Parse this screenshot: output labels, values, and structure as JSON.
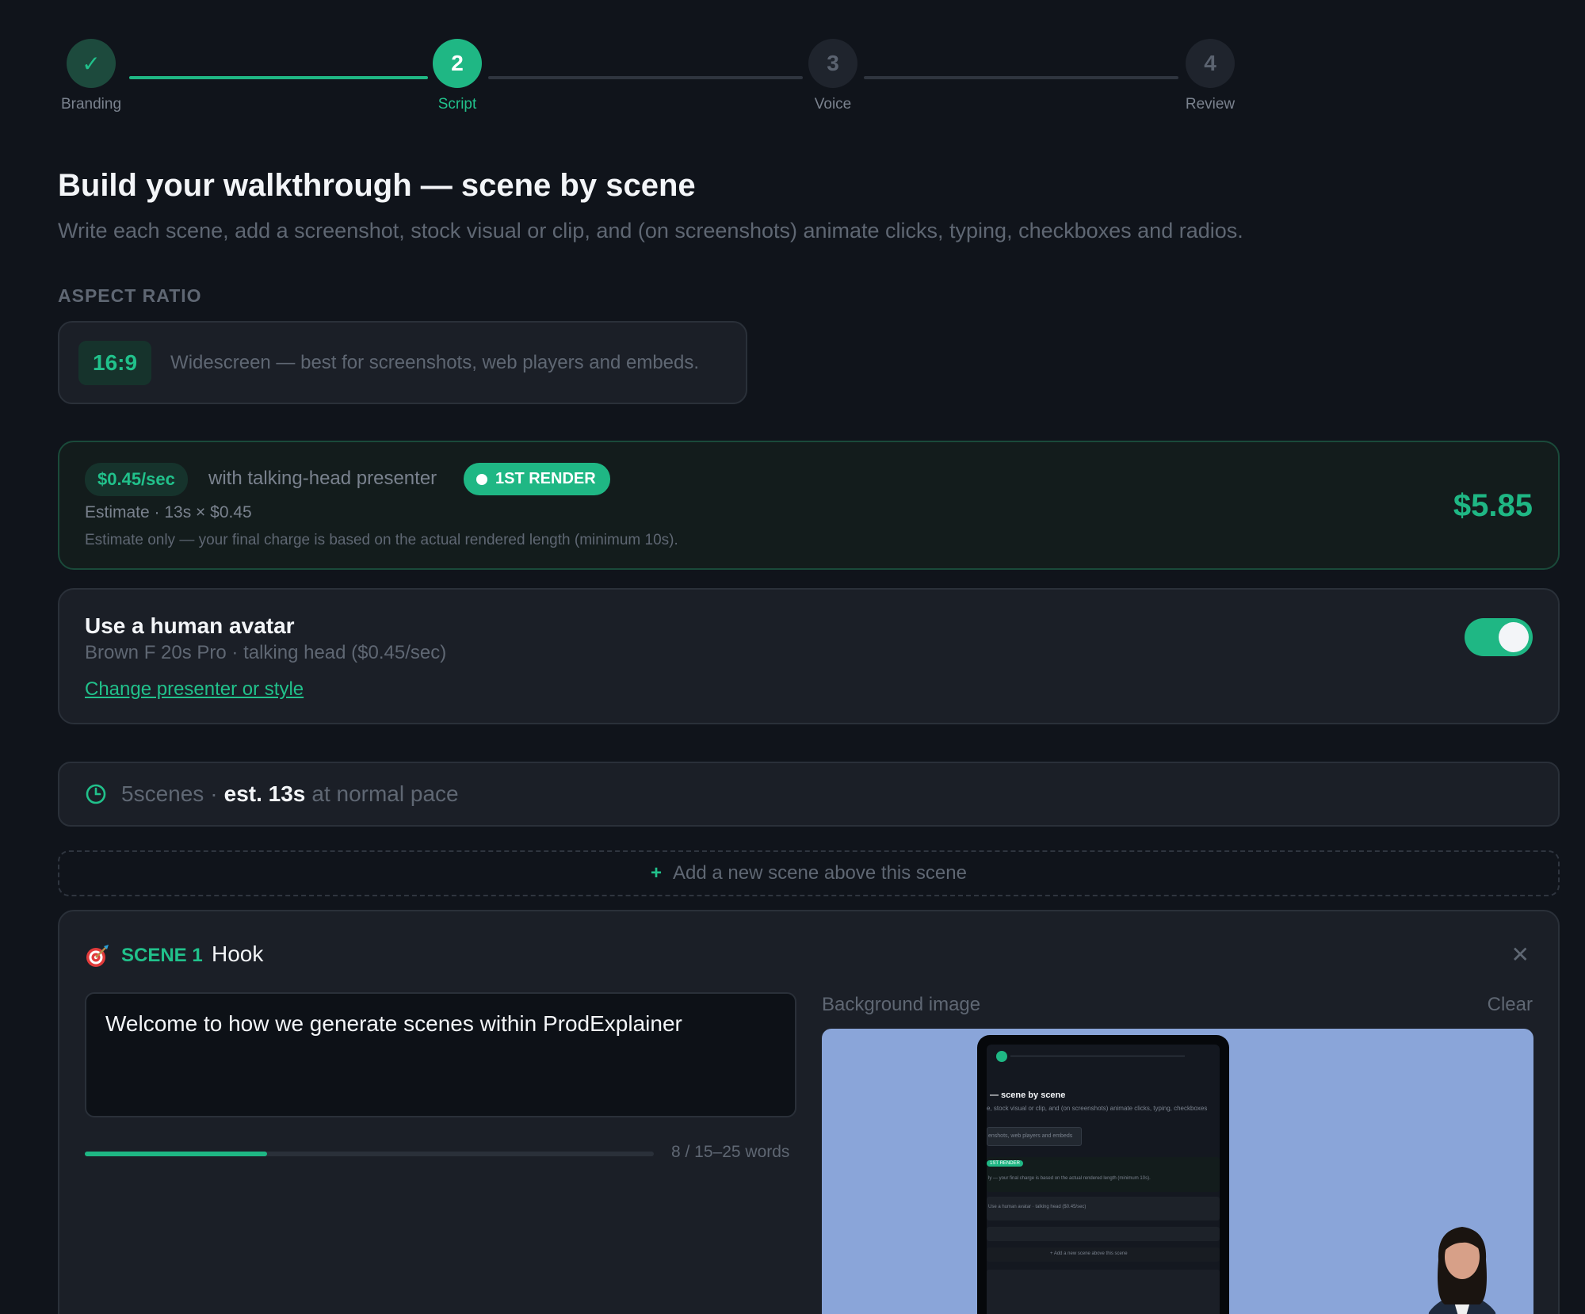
{
  "stepper": {
    "steps": [
      {
        "label": "Branding",
        "number": "✓",
        "state": "done"
      },
      {
        "label": "Script",
        "number": "2",
        "state": "active"
      },
      {
        "label": "Voice",
        "number": "3",
        "state": "todo"
      },
      {
        "label": "Review",
        "number": "4",
        "state": "todo"
      }
    ]
  },
  "header": {
    "title": "Build your walkthrough — scene by scene",
    "subtitle": "Write each scene, add a screenshot, stock visual or clip, and (on screenshots) animate clicks, typing, checkboxes and radios."
  },
  "aspect": {
    "label": "ASPECT RATIO",
    "value": "16:9",
    "description": "Widescreen — best for screenshots, web players and embeds."
  },
  "pricing": {
    "rate": "$0.45/sec",
    "rate_text": "with talking-head presenter",
    "badge": "1ST RENDER",
    "estimate": "Estimate · 13s × $0.45",
    "note": "Estimate only — your final charge is based on the actual rendered length (minimum 10s).",
    "total": "$5.85",
    "accent": "#1fb784"
  },
  "avatar": {
    "title": "Use a human avatar",
    "subtitle": "Brown F 20s Pro · talking head ($0.45/sec)",
    "link": "Change presenter or style",
    "enabled": true
  },
  "summary": {
    "scenes": "5scenes",
    "separator": "·",
    "duration": "est. 13s",
    "pace": "at normal pace"
  },
  "add_scene": {
    "plus": "+",
    "label": "Add a new scene above this scene"
  },
  "scene": {
    "icon": "target-icon",
    "number_label": "SCENE 1",
    "name": "Hook",
    "close": "✕",
    "text": "Welcome to how we generate scenes within ProdExplainer",
    "word_progress": 0.32,
    "word_count": "8 / 15–25 words",
    "background_label": "Background image",
    "clear_label": "Clear",
    "preview": {
      "heading": "— scene by scene",
      "subline": "e, stock visual or clip, and (on screenshots) animate clicks, typing, checkboxes",
      "chip_text": "enshots, web players and embeds",
      "badge": "1ST RENDER",
      "note": "ly — your final charge is based on the actual rendered length (minimum 10s).",
      "avatar_line": "Use a human avatar · talking head ($0.45/sec)",
      "add_scene": "+ Add a new scene above this scene"
    }
  }
}
